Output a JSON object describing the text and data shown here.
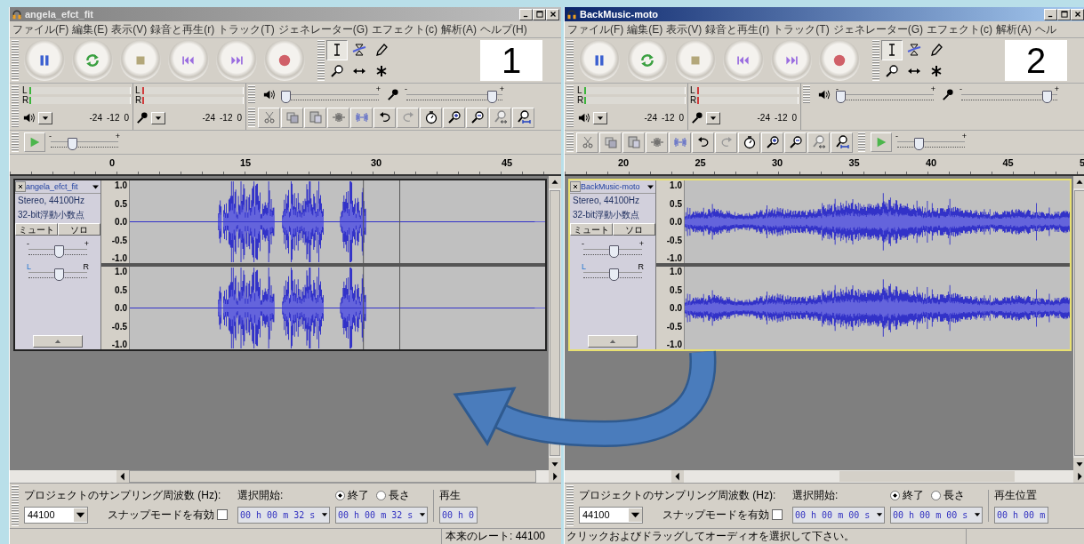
{
  "windows": [
    {
      "title": "angela_efct_fit",
      "active": false,
      "kind": "stacked",
      "menu": [
        "ファイル(F)",
        "編集(E)",
        "表示(V)",
        "録音と再生(r)",
        "トラック(T)",
        "ジェネレーター(G)",
        "エフェクト(c)",
        "解析(A)",
        "ヘルプ(H)"
      ],
      "meters": [
        {
          "kind": "playback",
          "channels": [
            "L",
            "R"
          ],
          "scale": [
            "-24",
            "-12",
            "0"
          ]
        },
        {
          "kind": "record",
          "channels": [
            "L",
            "R"
          ],
          "scale": [
            "-24",
            "-12",
            "0"
          ]
        }
      ],
      "output_slider": {
        "max": "+",
        "level": 0.02
      },
      "input_slider": {
        "min": "-",
        "max": "+",
        "level": 0.88
      },
      "speed_slider": {
        "min": "-",
        "max": "+",
        "level": 0.3
      },
      "ruler": [
        "0",
        "15",
        "30",
        "45"
      ],
      "track": {
        "name": "angela_efct_fit",
        "selected": false,
        "info": [
          "Stereo, 44100Hz",
          "32-bit浮動小数点"
        ],
        "mute": "ミュート",
        "solo": "ソロ",
        "gain": {
          "min": "-",
          "max": "+",
          "level": 0.5
        },
        "pan": {
          "min": "L",
          "max": "R",
          "level": 0.5
        },
        "channels": [
          {
            "scale": [
              "1.0",
              "0.5",
              "0.0",
              "-0.5",
              "-1.0"
            ]
          },
          {
            "scale": [
              "1.0",
              "0.5",
              "0.0",
              "-0.5",
              "-1.0"
            ]
          }
        ]
      },
      "selection_bar": {
        "rate_label": "プロジェクトのサンプリング周波数 (Hz):",
        "rate": "44100",
        "snap_label": "スナップモードを有効",
        "snap_checked": false,
        "start_label": "選択開始:",
        "start_time": "00 h 00 m 32 s",
        "radios": [
          {
            "label": "終了",
            "selected": true
          },
          {
            "label": "長さ",
            "selected": false
          }
        ],
        "end_time": "00 h 00 m 32 s",
        "position_label": "再生",
        "position_time": "00 h 0"
      },
      "status": {
        "rate": "本来のレート: 44100"
      }
    },
    {
      "title": "BackMusic-moto",
      "active": true,
      "kind": "inline",
      "menu": [
        "ファイル(F)",
        "編集(E)",
        "表示(V)",
        "録音と再生(r)",
        "トラック(T)",
        "ジェネレーター(G)",
        "エフェクト(c)",
        "解析(A)",
        "ヘル"
      ],
      "meters": [
        {
          "kind": "playback",
          "channels": [
            "L",
            "R"
          ],
          "scale": [
            "-24",
            "-12",
            "0"
          ]
        },
        {
          "kind": "record",
          "channels": [
            "L",
            "R"
          ],
          "scale": [
            "-24",
            "-12",
            "0"
          ]
        }
      ],
      "output_slider": {
        "min": "-",
        "max": "+",
        "level": 0.02
      },
      "input_slider": {
        "min": "-",
        "max": "+",
        "level": 0.88
      },
      "speed_slider": {
        "min": "-",
        "max": "+",
        "level": 0.3
      },
      "ruler": [
        "20",
        "25",
        "30",
        "35",
        "40",
        "45",
        "5"
      ],
      "track": {
        "name": "BackMusic-moto",
        "selected": true,
        "info": [
          "Stereo, 44100Hz",
          "32-bit浮動小数点"
        ],
        "mute": "ミュート",
        "solo": "ソロ",
        "gain": {
          "min": "-",
          "max": "+",
          "level": 0.5
        },
        "pan": {
          "min": "L",
          "max": "R",
          "level": 0.5
        },
        "channels": [
          {
            "scale": [
              "1.0",
              "0.5",
              "0.0",
              "-0.5",
              "-1.0"
            ]
          },
          {
            "scale": [
              "1.0",
              "0.5",
              "0.0",
              "-0.5",
              "-1.0"
            ]
          }
        ]
      },
      "selection_bar": {
        "rate_label": "プロジェクトのサンプリング周波数 (Hz):",
        "rate": "44100",
        "snap_label": "スナップモードを有効",
        "snap_checked": false,
        "start_label": "選択開始:",
        "start_time": "00 h 00 m 00 s",
        "radios": [
          {
            "label": "終了",
            "selected": true
          },
          {
            "label": "長さ",
            "selected": false
          }
        ],
        "end_time": "00 h 00 m 00 s",
        "position_label": "再生位置",
        "position_time": "00 h 00 m"
      },
      "status": {
        "message": "クリックおよびドラッグしてオーディオを選択して下さい。"
      }
    }
  ],
  "callouts": [
    "1",
    "2"
  ]
}
